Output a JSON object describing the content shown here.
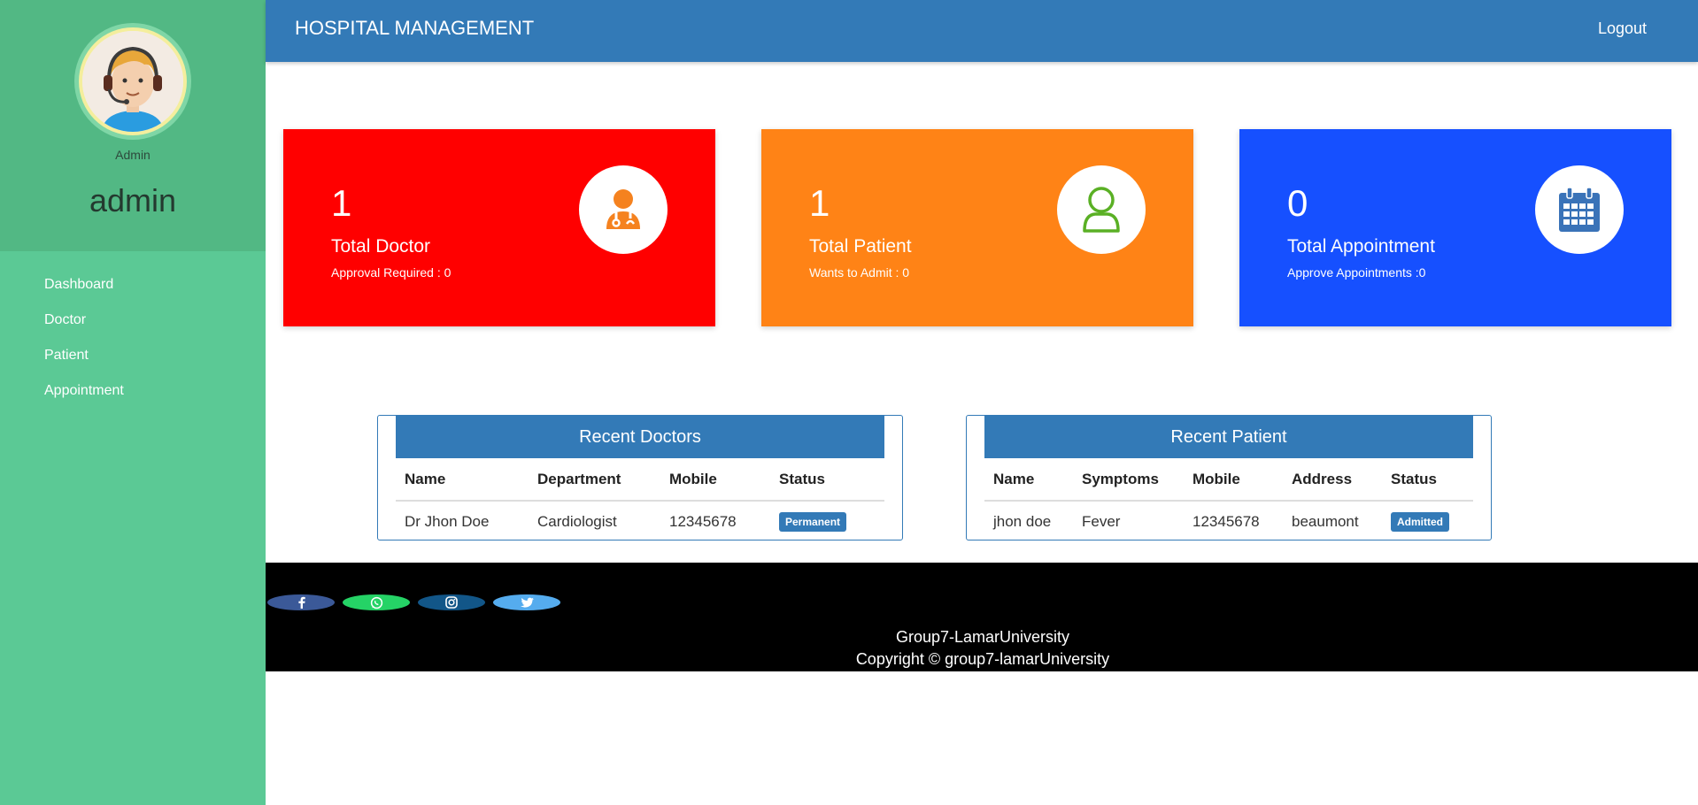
{
  "sidebar": {
    "role": "Admin",
    "username": "admin",
    "items": [
      {
        "label": "Dashboard"
      },
      {
        "label": "Doctor"
      },
      {
        "label": "Patient"
      },
      {
        "label": "Appointment"
      }
    ]
  },
  "header": {
    "title": "HOSPITAL MANAGEMENT",
    "logout": "Logout"
  },
  "cards": [
    {
      "value": "1",
      "label": "Total Doctor",
      "sub": "Approval Required : 0",
      "color": "#ff0000",
      "icon": "doctor-icon",
      "icon_color": "#f5821f"
    },
    {
      "value": "1",
      "label": "Total Patient",
      "sub": "Wants to Admit : 0",
      "color": "#ff8316",
      "icon": "user-icon",
      "icon_color": "#5ab025"
    },
    {
      "value": "0",
      "label": "Total Appointment",
      "sub": "Approve Appointments :0",
      "color": "#1650ff",
      "icon": "calendar-icon",
      "icon_color": "#3a73b8"
    }
  ],
  "recent_doctors": {
    "title": "Recent Doctors",
    "columns": [
      "Name",
      "Department",
      "Mobile",
      "Status"
    ],
    "rows": [
      {
        "name": "Dr Jhon Doe",
        "department": "Cardiologist",
        "mobile": "12345678",
        "status": "Permanent"
      }
    ]
  },
  "recent_patients": {
    "title": "Recent Patient",
    "columns": [
      "Name",
      "Symptoms",
      "Mobile",
      "Address",
      "Status"
    ],
    "rows": [
      {
        "name": "jhon doe",
        "symptoms": "Fever",
        "mobile": "12345678",
        "address": "beaumont",
        "status": "Admitted"
      }
    ]
  },
  "footer": {
    "social": [
      {
        "icon": "facebook-icon",
        "color": "#3b5998"
      },
      {
        "icon": "whatsapp-icon",
        "color": "#25d366"
      },
      {
        "icon": "instagram-icon",
        "color": "#125688"
      },
      {
        "icon": "twitter-icon",
        "color": "#55acee"
      }
    ],
    "line1": "Group7-LamarUniversity",
    "line2": "Copyright © group7-lamarUniversity"
  }
}
